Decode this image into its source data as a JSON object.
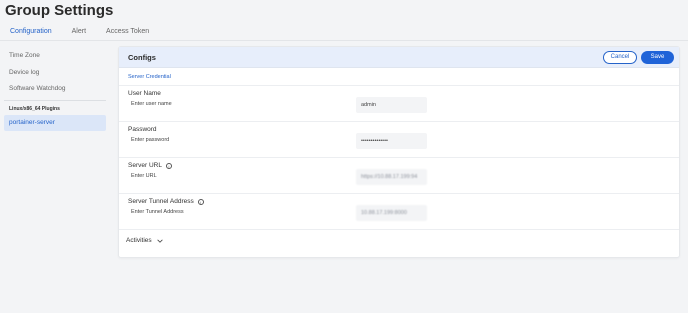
{
  "page": {
    "title": "Group Settings"
  },
  "tabs": [
    {
      "label": "Configuration",
      "active": true
    },
    {
      "label": "Alert",
      "active": false
    },
    {
      "label": "Access Token",
      "active": false
    }
  ],
  "sidebar": {
    "items": [
      {
        "label": "Time Zone"
      },
      {
        "label": "Device log"
      },
      {
        "label": "Software Watchdog"
      }
    ],
    "section_heading": "Linux/x86_64 Plugins",
    "plugin_items": [
      {
        "label": "portainer-server",
        "selected": true
      }
    ]
  },
  "panel": {
    "title": "Configs",
    "cancel_label": "Cancel",
    "save_label": "Save",
    "credential_link": "Server Credential",
    "fields": [
      {
        "label": "User Name",
        "hint": "Enter user name",
        "value": "admin",
        "info": false
      },
      {
        "label": "Password",
        "hint": "Enter password",
        "value": "••••••••••••••",
        "info": false
      },
      {
        "label": "Server URL",
        "hint": "Enter URL",
        "value": "https://10.88.17.199:94",
        "info": true
      },
      {
        "label": "Server Tunnel Address",
        "hint": "Enter Tunnel Address",
        "value": "10.88.17.199:8000",
        "info": true
      }
    ],
    "activities_label": "Activities"
  },
  "colors": {
    "accent": "#1f63d8",
    "header_bg": "#e7eefb",
    "selected_bg": "#dbe6f8"
  }
}
